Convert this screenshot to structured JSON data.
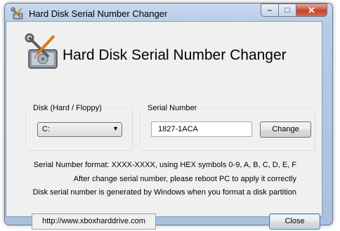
{
  "window": {
    "title": "Hard Disk Serial Number Changer"
  },
  "header": {
    "app_title": "Hard Disk Serial Number Changer",
    "icon": "hard-disk-wrench-icon"
  },
  "disk_group": {
    "legend": "Disk (Hard / Floppy)",
    "selected_drive": "C:"
  },
  "serial_group": {
    "legend": "Serial Number",
    "serial_value": "1827-1ACA",
    "change_label": "Change"
  },
  "info": {
    "line1": "Serial Number format: XXXX-XXXX, using HEX symbols 0-9, A, B, C, D, E, F",
    "line2": "After change serial number, please reboot PC to apply it correctly",
    "line3": "Disk serial number is generated by Windows when you format a disk partition"
  },
  "footer": {
    "link_text": "http://www.xboxharddrive.com",
    "close_label": "Close"
  },
  "colors": {
    "titlebar": "#b6cbe6",
    "client_bg": "#f0f0f0",
    "close_button": "#c8442a"
  }
}
